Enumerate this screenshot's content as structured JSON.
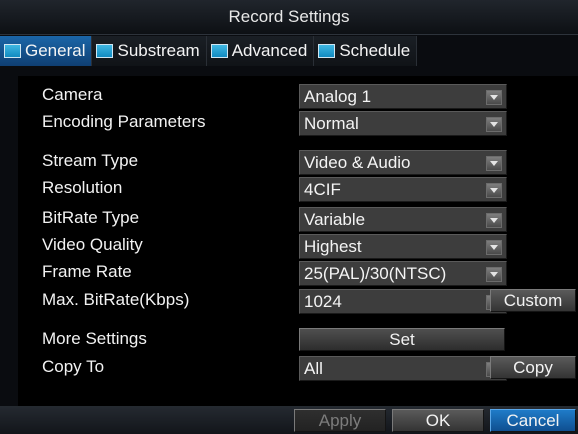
{
  "window": {
    "title": "Record Settings"
  },
  "tabs": [
    {
      "label": "General",
      "active": true
    },
    {
      "label": "Substream",
      "active": false
    },
    {
      "label": "Advanced",
      "active": false
    },
    {
      "label": "Schedule",
      "active": false
    }
  ],
  "settings": {
    "camera": {
      "label": "Camera",
      "value": "Analog 1"
    },
    "encoding_parameters": {
      "label": "Encoding Parameters",
      "value": "Normal"
    },
    "stream_type": {
      "label": "Stream Type",
      "value": "Video & Audio"
    },
    "resolution": {
      "label": "Resolution",
      "value": "4CIF"
    },
    "bitrate_type": {
      "label": "BitRate Type",
      "value": "Variable"
    },
    "video_quality": {
      "label": "Video Quality",
      "value": "Highest"
    },
    "frame_rate": {
      "label": "Frame Rate",
      "value": "25(PAL)/30(NTSC)"
    },
    "max_bitrate": {
      "label": "Max. BitRate(Kbps)",
      "value": "1024"
    },
    "more_settings": {
      "label": "More Settings"
    },
    "copy_to": {
      "label": "Copy To",
      "value": "All"
    }
  },
  "buttons": {
    "custom": "Custom",
    "set": "Set",
    "copy": "Copy",
    "apply": "Apply",
    "ok": "OK",
    "cancel": "Cancel"
  },
  "colors": {
    "accent": "#1b66a8",
    "tab_icon": "#2aa7d6",
    "panel_bg": "#000000",
    "select_bg": "#3d3d3d"
  }
}
